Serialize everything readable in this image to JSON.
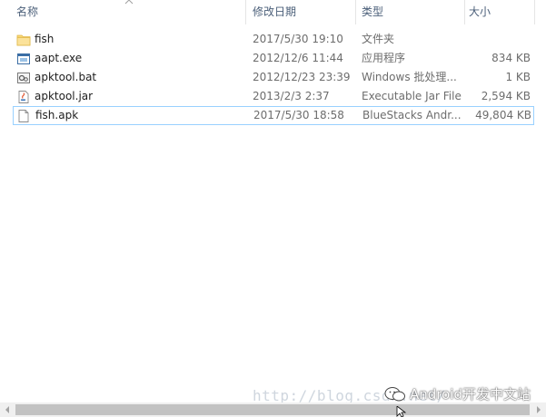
{
  "columns": {
    "name": "名称",
    "date": "修改日期",
    "type": "类型",
    "size": "大小"
  },
  "files": [
    {
      "name": "fish",
      "date": "2017/5/30 19:10",
      "type": "文件夹",
      "size": "",
      "icon": "folder-icon"
    },
    {
      "name": "aapt.exe",
      "date": "2012/12/6 11:44",
      "type": "应用程序",
      "size": "834 KB",
      "icon": "exe-icon"
    },
    {
      "name": "apktool.bat",
      "date": "2012/12/23 23:39",
      "type": "Windows 批处理...",
      "size": "1 KB",
      "icon": "bat-icon"
    },
    {
      "name": "apktool.jar",
      "date": "2013/2/3 2:37",
      "type": "Executable Jar File",
      "size": "2,594 KB",
      "icon": "jar-icon"
    },
    {
      "name": "fish.apk",
      "date": "2017/5/30 18:58",
      "type": "BlueStacks Andr...",
      "size": "49,804 KB",
      "icon": "apk-file-icon"
    }
  ],
  "watermark": {
    "url": "http://blog.csdn.net/",
    "brand": "Android开发中文站"
  },
  "colors": {
    "header_text": "#4c607a",
    "focus_border": "#99d1ff",
    "folder": "#f8d775"
  }
}
